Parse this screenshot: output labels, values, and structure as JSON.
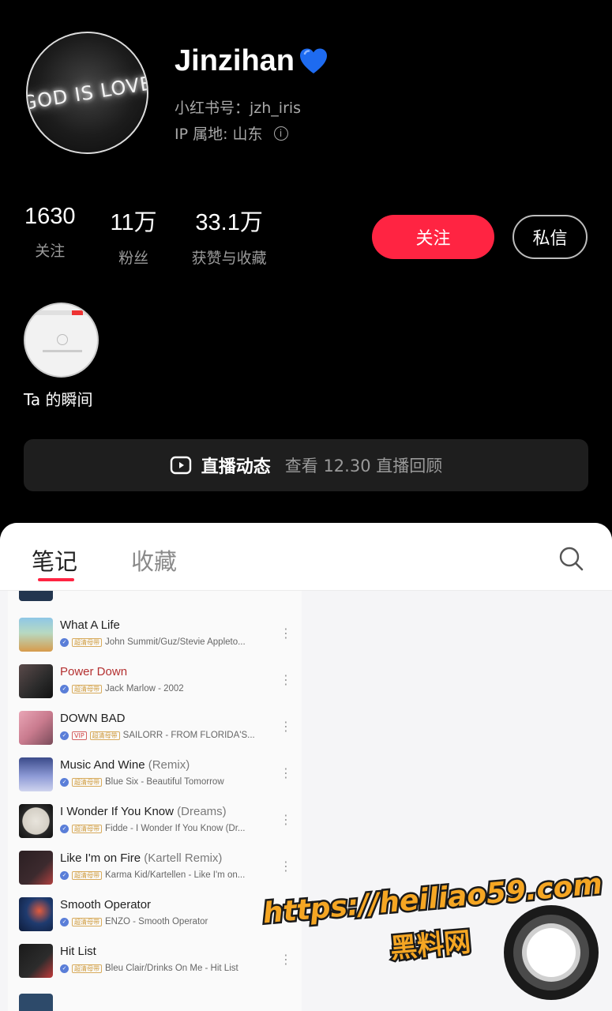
{
  "profile": {
    "avatar_text": "GOD IS LOVE",
    "name": "Jinzihan",
    "id_text": "小红书号：jzh_iris",
    "ip_text": "IP 属地: 山东"
  },
  "stats": [
    {
      "value": "1630",
      "label": "关注"
    },
    {
      "value": "11万",
      "label": "粉丝"
    },
    {
      "value": "33.1万",
      "label": "获赞与收藏"
    }
  ],
  "actions": {
    "follow": "关注",
    "message": "私信"
  },
  "moment": {
    "label": "Ta 的瞬间"
  },
  "live": {
    "title": "直播动态",
    "subtitle": "查看 12.30 直播回顾"
  },
  "tabs": {
    "notes": "笔记",
    "collections": "收藏"
  },
  "songs": [
    {
      "title": "What A Life",
      "subtitle": "",
      "badges": [
        "超清母带"
      ],
      "artist": "John Summit/Guz/Stevie Appleto...",
      "active": false
    },
    {
      "title": "Power Down",
      "subtitle": "",
      "badges": [
        "超清母带"
      ],
      "artist": "Jack Marlow - 2002",
      "active": true
    },
    {
      "title": "DOWN BAD",
      "subtitle": "",
      "badges": [
        "VIP",
        "超清母带"
      ],
      "artist": "SAILORR - FROM FLORIDA'S...",
      "active": false
    },
    {
      "title": "Music And Wine",
      "subtitle": "(Remix)",
      "badges": [
        "超清母带"
      ],
      "artist": "Blue Six - Beautiful Tomorrow",
      "active": false
    },
    {
      "title": "I Wonder If You Know",
      "subtitle": "(Dreams)",
      "badges": [
        "超清母带"
      ],
      "artist": "Fidde - I Wonder If You Know (Dr...",
      "active": false
    },
    {
      "title": "Like I'm on Fire",
      "subtitle": "(Kartell Remix)",
      "badges": [
        "超清母带"
      ],
      "artist": "Karma Kid/Kartellen - Like I'm on...",
      "active": false
    },
    {
      "title": "Smooth Operator",
      "subtitle": "",
      "badges": [
        "超清母带"
      ],
      "artist": "ENZO - Smooth Operator",
      "active": false
    },
    {
      "title": "Hit List",
      "subtitle": "",
      "badges": [
        "超清母带"
      ],
      "artist": "Bleu Clair/Drinks On Me - Hit List",
      "active": false
    }
  ],
  "watermark": {
    "line1": "https://heiliao59.com",
    "line2": "黑料网"
  },
  "colors": {
    "accent": "#ff2442",
    "watermark": "#f5a623"
  }
}
